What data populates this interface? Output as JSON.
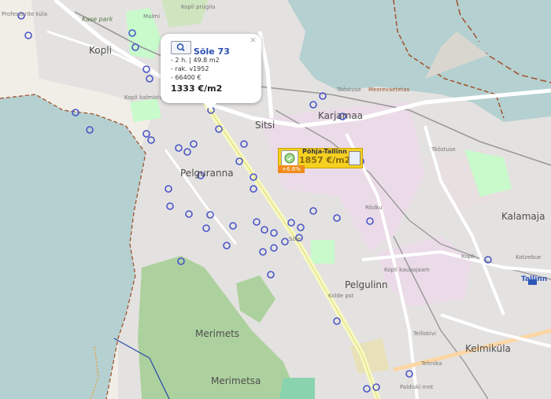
{
  "map": {
    "colors": {
      "water": "#b5d0d0",
      "land": "#f1eee8",
      "residential": "#e0dfdf",
      "industrial": "#ebdbe8",
      "park": "#c8facc",
      "forest": "#add19e",
      "road_major": "#fcd6a4",
      "road_yellow": "#f7fabf",
      "railway": "#999999",
      "marker": "#4a55c8",
      "admin_border": "#a0522d"
    },
    "districts": [
      "Kopli",
      "Sitsi",
      "Karjamaa",
      "Pelgulinn",
      "Kalamaja",
      "Merimetsa",
      "Kelmiküla",
      "Pelguranna",
      "Merimets",
      "Tallinn"
    ],
    "street_labels": [
      "Malmi",
      "Kopli",
      "Sõle",
      "Tööstuse",
      "Rõdku",
      "Kolde pst",
      "Telliskivi",
      "Tehnika",
      "Paldiski mnt",
      "Kotzebue",
      "Kopli kaubajaam",
      "Kopli kalmistu",
      "Kopli prügila",
      "Kase park",
      "Mere",
      "Professorite küla"
    ],
    "water_labels": [
      "Meerevaetetas"
    ]
  },
  "popup": {
    "title": "Sõle 73",
    "search_icon": "magnifier-icon",
    "close": "×",
    "lines": [
      "- 2 h. | 49.8 m2",
      "- rak. v1952",
      "- 66400 €"
    ],
    "price": "1333 €/m2"
  },
  "area_marker": {
    "name": "Põhja-Tallinn",
    "price": "1857 €/m2",
    "change": "+6.6%",
    "icon_left": "district-icon",
    "icon_right": "building-icon"
  }
}
